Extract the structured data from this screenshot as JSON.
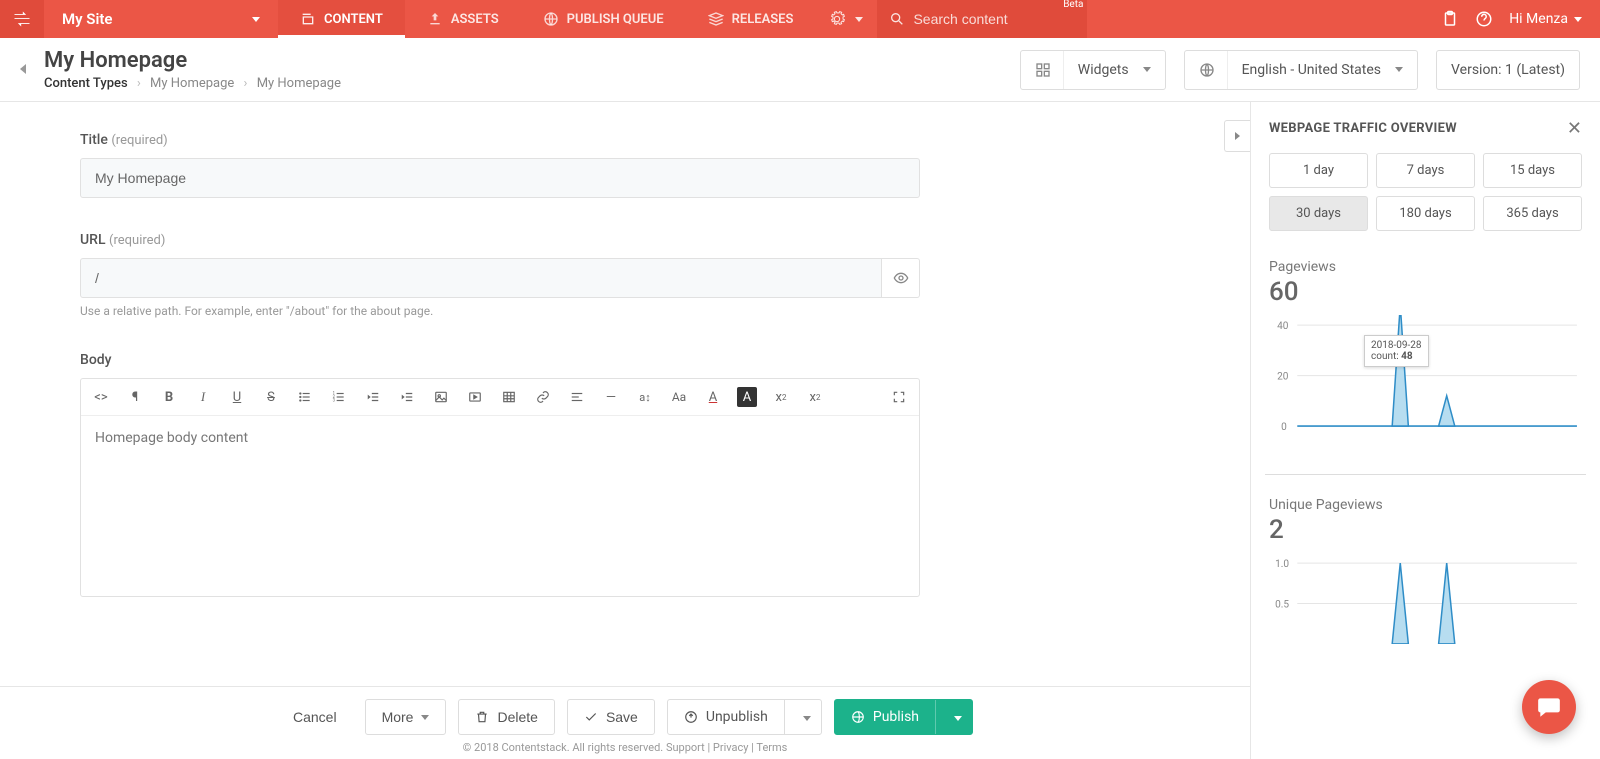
{
  "topbar": {
    "site_name": "My Site",
    "tabs": {
      "content": "CONTENT",
      "assets": "ASSETS",
      "publish_queue": "PUBLISH QUEUE",
      "releases": "RELEASES"
    },
    "search_placeholder": "Search content",
    "beta": "Beta",
    "greeting": "Hi  Menza"
  },
  "page": {
    "title": "My Homepage",
    "crumb1": "Content Types",
    "crumb2": "My Homepage",
    "crumb3": "My Homepage",
    "widgets_label": "Widgets",
    "locale_label": "English - United States",
    "version_label": "Version: 1 (Latest)"
  },
  "form": {
    "title_label": "Title",
    "required": "(required)",
    "title_value": "My Homepage",
    "url_label": "URL",
    "url_value": "/",
    "url_hint": "Use a relative path. For example, enter \"/about\" for the about page.",
    "body_label": "Body",
    "body_content": "Homepage body content"
  },
  "sidebar": {
    "heading": "WEBPAGE TRAFFIC OVERVIEW",
    "ranges": [
      "1 day",
      "7 days",
      "15 days",
      "30 days",
      "180 days",
      "365 days"
    ],
    "active_range_index": 3,
    "pageviews_label": "Pageviews",
    "pageviews_value": "60",
    "tooltip_date": "2018-09-28",
    "tooltip_count_label": "count:",
    "tooltip_count": "48",
    "unique_label": "Unique Pageviews",
    "unique_value": "2"
  },
  "footer": {
    "cancel": "Cancel",
    "more": "More",
    "delete": "Delete",
    "save": "Save",
    "unpublish": "Unpublish",
    "publish": "Publish",
    "copy_prefix": "© 2018 Contentstack. All rights reserved.",
    "support": "Support",
    "privacy": "Privacy",
    "terms": "Terms"
  },
  "chart_data": [
    {
      "type": "line",
      "title": "Pageviews",
      "ylabel": "",
      "ylim": [
        0,
        50
      ],
      "y_ticks": [
        0,
        20,
        40
      ],
      "tooltip": {
        "date": "2018-09-28",
        "count": 48
      },
      "series": [
        {
          "name": "pageviews",
          "values": [
            0,
            0,
            0,
            0,
            0,
            0,
            0,
            0,
            0,
            0,
            0,
            0,
            48,
            0,
            0,
            0,
            0,
            12,
            0,
            0,
            0,
            0,
            0,
            0,
            0,
            0,
            0,
            0,
            0,
            0
          ]
        }
      ]
    },
    {
      "type": "line",
      "title": "Unique Pageviews",
      "ylabel": "",
      "ylim": [
        0,
        1
      ],
      "y_ticks": [
        0.5,
        1.0
      ],
      "series": [
        {
          "name": "unique_pageviews",
          "values": [
            0,
            0,
            0,
            0,
            0,
            0,
            0,
            0,
            0,
            0,
            0,
            0,
            1,
            0,
            0,
            0,
            0,
            1,
            0,
            0,
            0,
            0,
            0,
            0,
            0,
            0,
            0,
            0,
            0,
            0
          ]
        }
      ]
    }
  ]
}
